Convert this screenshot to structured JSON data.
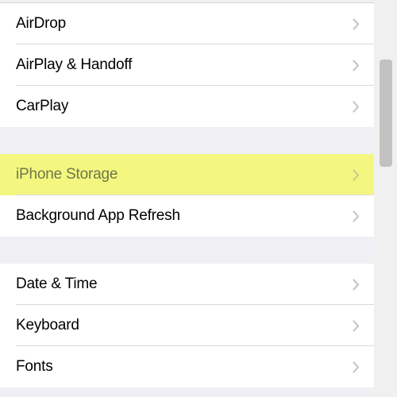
{
  "groups": [
    {
      "items": [
        {
          "label": "AirDrop",
          "name": "airdrop",
          "highlighted": false
        },
        {
          "label": "AirPlay & Handoff",
          "name": "airplay-handoff",
          "highlighted": false
        },
        {
          "label": "CarPlay",
          "name": "carplay",
          "highlighted": false
        }
      ]
    },
    {
      "items": [
        {
          "label": "iPhone Storage",
          "name": "iphone-storage",
          "highlighted": true
        },
        {
          "label": "Background App Refresh",
          "name": "background-app-refresh",
          "highlighted": false
        }
      ]
    },
    {
      "items": [
        {
          "label": "Date & Time",
          "name": "date-time",
          "highlighted": false
        },
        {
          "label": "Keyboard",
          "name": "keyboard",
          "highlighted": false
        },
        {
          "label": "Fonts",
          "name": "fonts",
          "highlighted": false
        }
      ]
    }
  ]
}
